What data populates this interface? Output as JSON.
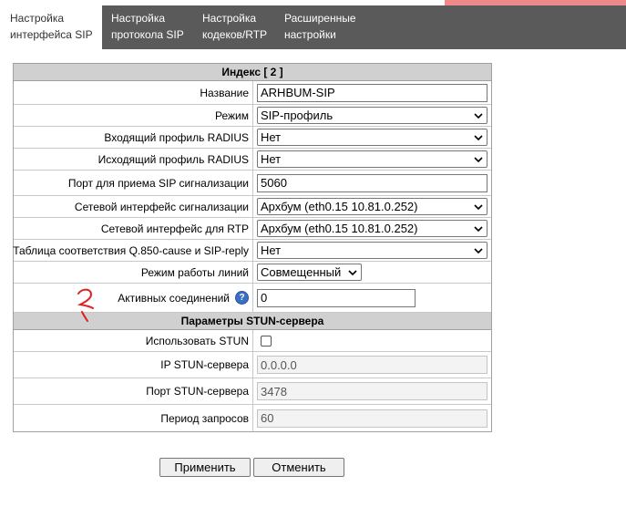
{
  "tabs": [
    {
      "line1": "Настройка",
      "line2": "интерфейса SIP"
    },
    {
      "line1": "Настройка",
      "line2": "протокола SIP"
    },
    {
      "line1": "Настройка",
      "line2": "кодеков/RTP"
    },
    {
      "line1": "Расширенные",
      "line2": "настройки"
    }
  ],
  "section1": {
    "title": "Индекс [ 2 ]",
    "name": {
      "label": "Название",
      "value": "ARHBUM-SIP"
    },
    "mode": {
      "label": "Режим",
      "value": "SIP-профиль"
    },
    "radius_in": {
      "label": "Входящий профиль RADIUS",
      "value": "Нет"
    },
    "radius_out": {
      "label": "Исходящий профиль RADIUS",
      "value": "Нет"
    },
    "sip_port": {
      "label": "Порт для приема SIP сигнализации",
      "value": "5060"
    },
    "sig_iface": {
      "label": "Сетевой интерфейс сигнализации",
      "value": "Архбум (eth0.15 10.81.0.252)"
    },
    "rtp_iface": {
      "label": "Сетевой интерфейс для RTP",
      "value": "Архбум (eth0.15 10.81.0.252)"
    },
    "q850": {
      "label": "Таблица соответствия Q.850-cause и SIP-reply",
      "value": "Нет"
    },
    "line_mode": {
      "label": "Режим работы линий",
      "value": "Совмещенный"
    },
    "active_conn": {
      "label": "Активных соединений",
      "help": "?",
      "value": "0"
    }
  },
  "section2": {
    "title": "Параметры STUN-сервера",
    "use_stun": {
      "label": "Использовать STUN",
      "checked": false
    },
    "stun_ip": {
      "label": "IP STUN-сервера",
      "value": "0.0.0.0"
    },
    "stun_port": {
      "label": "Порт STUN-сервера",
      "value": "3478"
    },
    "period": {
      "label": "Период запросов",
      "value": "60"
    }
  },
  "buttons": {
    "apply": "Применить",
    "cancel": "Отменить"
  },
  "colors": {
    "tabbar": "#5a5a5a",
    "section_header": "#d0d0d0",
    "help_icon": "#3b6fc4",
    "annotation": "#e02020"
  }
}
